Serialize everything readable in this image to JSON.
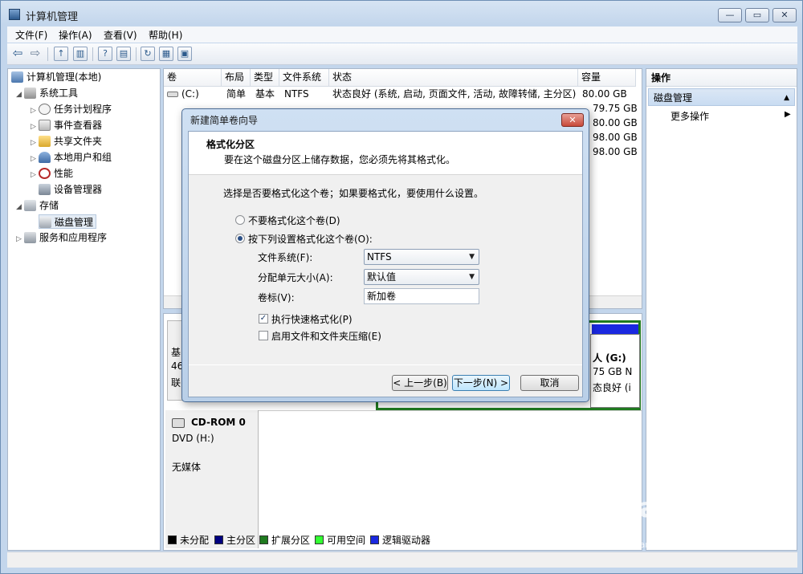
{
  "window": {
    "title": "计算机管理"
  },
  "menu": [
    "文件(F)",
    "操作(A)",
    "查看(V)",
    "帮助(H)"
  ],
  "tree": {
    "root": "计算机管理(本地)",
    "system_tools": "系统工具",
    "task_scheduler": "任务计划程序",
    "event_viewer": "事件查看器",
    "shared_folders": "共享文件夹",
    "local_users": "本地用户和组",
    "performance": "性能",
    "device_manager": "设备管理器",
    "storage": "存储",
    "disk_management": "磁盘管理",
    "services_apps": "服务和应用程序"
  },
  "volume_table": {
    "headers": [
      "卷",
      "布局",
      "类型",
      "文件系统",
      "状态",
      "容量"
    ],
    "row1": {
      "volume": "(C:)",
      "layout": "简单",
      "type": "基本",
      "fs": "NTFS",
      "status": "状态良好 (系统, 启动, 页面文件, 活动, 故障转储, 主分区)",
      "capacity": "80.00 GB"
    },
    "partial_capacities": [
      "79.75 GB",
      "80.00 GB",
      "98.00 GB",
      "98.00 GB"
    ]
  },
  "disk_area": {
    "disk0_label_partial": [
      "基",
      "46",
      "联"
    ],
    "g_volume_partial": [
      "人  (G:)",
      "75 GB N",
      "态良好 (i"
    ],
    "cdrom_name": "CD-ROM 0",
    "cdrom_type": "DVD (H:)",
    "cdrom_media": "无媒体"
  },
  "legend": [
    {
      "label": "未分配",
      "color": "#000000"
    },
    {
      "label": "主分区",
      "color": "#000080"
    },
    {
      "label": "扩展分区",
      "color": "#1f7a1f"
    },
    {
      "label": "可用空间",
      "color": "#33ff33"
    },
    {
      "label": "逻辑驱动器",
      "color": "#1a28e0"
    }
  ],
  "actions": {
    "header": "操作",
    "section": "磁盘管理",
    "more": "更多操作"
  },
  "dialog": {
    "title": "新建简单卷向导",
    "heading": "格式化分区",
    "subheading": "要在这个磁盘分区上储存数据，您必须先将其格式化。",
    "prompt": "选择是否要格式化这个卷；如果要格式化，要使用什么设置。",
    "opt_no_format": "不要格式化这个卷(D)",
    "opt_format": "按下列设置格式化这个卷(O):",
    "fs_label": "文件系统(F):",
    "fs_value": "NTFS",
    "alloc_label": "分配单元大小(A):",
    "alloc_value": "默认值",
    "vol_label": "卷标(V):",
    "vol_value": "新加卷",
    "quick_format": "执行快速格式化(P)",
    "compression": "启用文件和文件夹压缩(E)",
    "back": "< 上一步(B)",
    "next": "下一步(N) >",
    "cancel": "取消"
  },
  "watermark": {
    "brand": "Bai du 经验",
    "url": "jingyan.baidu.com"
  }
}
